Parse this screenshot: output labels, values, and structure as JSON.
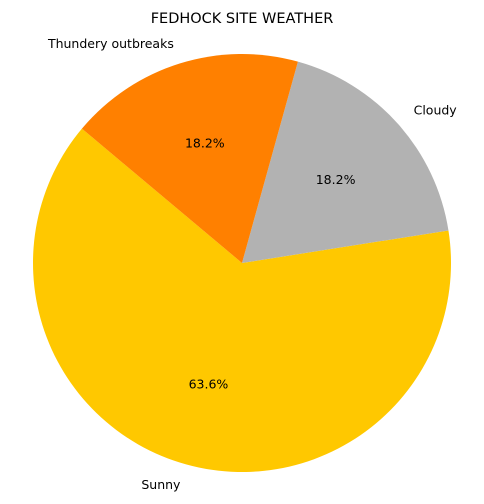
{
  "chart_data": {
    "type": "pie",
    "title": "FEDHOCK SITE WEATHER",
    "categories": [
      "Sunny",
      "Cloudy",
      "Thundery outbreaks"
    ],
    "values": [
      63.6,
      18.2,
      18.2
    ],
    "percent_labels": [
      "63.6%",
      "18.2%",
      "18.2%"
    ],
    "colors": [
      "#ffc800",
      "#b2b2b2",
      "#ff8000"
    ],
    "start_angle_deg": 140,
    "direction": "counterclockwise",
    "legend": "none"
  }
}
